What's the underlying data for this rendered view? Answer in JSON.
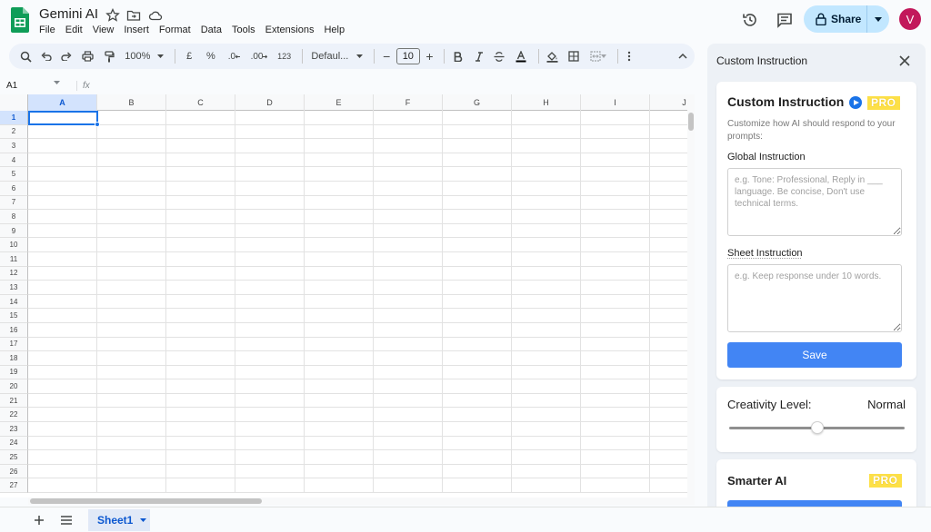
{
  "header": {
    "title": "Gemini AI",
    "menus": [
      "File",
      "Edit",
      "View",
      "Insert",
      "Format",
      "Data",
      "Tools",
      "Extensions",
      "Help"
    ],
    "share_label": "Share",
    "avatar_initial": "V"
  },
  "toolbar": {
    "zoom": "100%",
    "currency": "£",
    "percent": "%",
    "dec_decrease": ".0",
    "dec_increase": ".00",
    "number_format": "123",
    "font": "Defaul...",
    "font_size": "10",
    "minus": "−",
    "plus": "+"
  },
  "formula": {
    "cell_ref": "A1",
    "fx": "fx"
  },
  "grid": {
    "columns": [
      "A",
      "B",
      "C",
      "D",
      "E",
      "F",
      "G",
      "H",
      "I",
      "J"
    ],
    "rows": [
      "1",
      "2",
      "3",
      "4",
      "5",
      "6",
      "7",
      "8",
      "9",
      "10",
      "11",
      "12",
      "13",
      "14",
      "15",
      "16",
      "17",
      "18",
      "19",
      "20",
      "21",
      "22",
      "23",
      "24",
      "25",
      "26",
      "27"
    ],
    "selected_cell": "A1"
  },
  "sheets": {
    "tabs": [
      "Sheet1"
    ]
  },
  "panel": {
    "title": "Custom Instruction",
    "card_title": "Custom Instruction",
    "pro_label": "PRO",
    "description": "Customize how AI should respond to your prompts:",
    "global_label": "Global Instruction",
    "global_placeholder": "e.g. Tone: Professional, Reply in ___ language. Be concise, Don't use technical terms.",
    "sheet_label": "Sheet Instruction",
    "sheet_placeholder": "e.g. Keep response under 10 words.",
    "save_label": "Save",
    "creativity_label": "Creativity Level:",
    "creativity_value": "Normal",
    "creativity_level": 0.5,
    "smarter_label": "Smarter AI",
    "smarter_pro": "PRO"
  },
  "colors": {
    "accent": "#1a73e8",
    "save_button": "#4285f4",
    "pro_badge": "#fde047",
    "avatar": "#c2185b",
    "share_bg": "#c2e7ff"
  }
}
